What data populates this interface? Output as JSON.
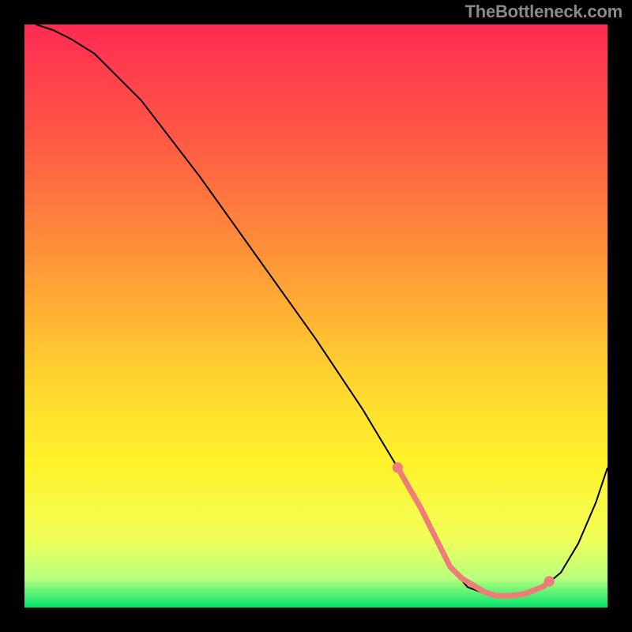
{
  "attribution": "TheBottleneck.com",
  "chart_data": {
    "type": "line",
    "title": "",
    "xlabel": "",
    "ylabel": "",
    "xlim": [
      0,
      100
    ],
    "ylim": [
      0,
      100
    ],
    "background_gradient": {
      "stops": [
        {
          "offset": 0.0,
          "color": "#ff2b53"
        },
        {
          "offset": 0.2,
          "color": "#ff5a45"
        },
        {
          "offset": 0.4,
          "color": "#ff9438"
        },
        {
          "offset": 0.6,
          "color": "#ffd22f"
        },
        {
          "offset": 0.75,
          "color": "#fff22a"
        },
        {
          "offset": 0.88,
          "color": "#f2ff57"
        },
        {
          "offset": 0.95,
          "color": "#b9ff7e"
        },
        {
          "offset": 1.0,
          "color": "#00e46a"
        }
      ]
    },
    "series": [
      {
        "name": "bottleneck-curve",
        "color": "#000000",
        "x": [
          2,
          5,
          8,
          12,
          20,
          30,
          40,
          50,
          58,
          64,
          68,
          71,
          73,
          76,
          80,
          84,
          87,
          89,
          92,
          95,
          98,
          100
        ],
        "y": [
          100,
          99,
          97.5,
          95,
          87,
          74,
          60,
          46,
          34,
          24,
          17,
          11,
          7,
          3.5,
          2,
          2,
          2.5,
          3.5,
          6,
          11,
          18,
          24
        ]
      }
    ],
    "marker_series": {
      "name": "highlight-band",
      "color": "#ef7c78",
      "x": [
        64,
        66,
        68,
        70,
        71,
        73,
        75,
        77,
        79,
        81,
        83,
        85,
        86,
        88,
        89,
        90
      ],
      "y": [
        24,
        20.5,
        17,
        13,
        11,
        7,
        5,
        3.8,
        2.6,
        2,
        2,
        2.2,
        2.4,
        3.2,
        3.6,
        4.5
      ]
    }
  }
}
